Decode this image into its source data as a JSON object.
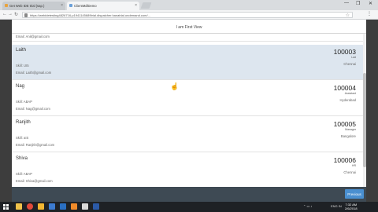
{
  "browser": {
    "tabs": [
      {
        "label": "Get Web IDE trial (sap.)",
        "active": false,
        "icon_color": "#e8a33d"
      },
      {
        "label": "ClientMdlDemo",
        "active": true,
        "icon_color": "#6aa0d8"
      }
    ],
    "url": "https://webidetesting4826716-p1941145689trial.dispatcher.hanatrial.ondemand.com/...",
    "window_controls": {
      "minimize": "—",
      "maximize": "❐",
      "close": "✕"
    }
  },
  "app": {
    "title": "I am First View",
    "previous_label": "Previous",
    "top_partial_email": "Email: Anil@gmail.com",
    "items": [
      {
        "name": "Laith",
        "skill": "Skill: UI5",
        "email": "Email: Laith@gmail.com",
        "id": "100003",
        "role": "Lad",
        "city": "Chennai",
        "selected": true
      },
      {
        "name": "Nag",
        "skill": "Skill: ABAP",
        "email": "Email: Nag@gmail.com",
        "id": "100004",
        "role": "Assistant",
        "city": "Hyderabad",
        "selected": false
      },
      {
        "name": "Ranjith",
        "skill": "Skill: aIS",
        "email": "Email: Ranjith@gmail.com",
        "id": "100005",
        "role": "Manager",
        "city": "Bangalore",
        "selected": false
      },
      {
        "name": "Shiva",
        "skill": "Skill: ABAP",
        "email": "Email: Shiva@gmail.com",
        "id": "100006",
        "role": "HR",
        "city": "Chennai",
        "selected": false
      }
    ]
  },
  "taskbar": {
    "pinned": [
      "explorer-icon",
      "chrome-icon",
      "folder-icon",
      "store-icon",
      "edge-icon",
      "app-icon",
      "file-icon",
      "word-icon"
    ],
    "language": "ENG\nIN",
    "time": "7:32 AM",
    "date": "2/6/2018"
  },
  "colors": {
    "accent": "#4a8fd0",
    "selected_row": "#dde6ef",
    "footer": "#3e4a54"
  }
}
